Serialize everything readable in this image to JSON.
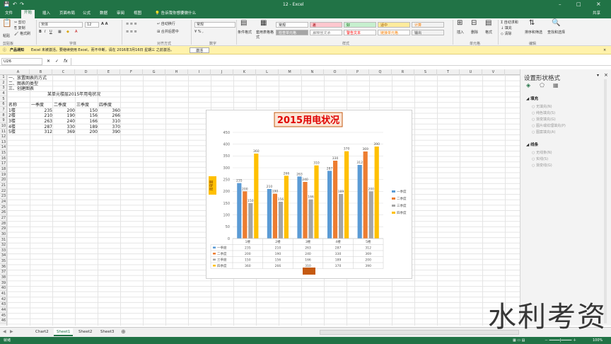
{
  "window": {
    "title": "12 - Excel",
    "share": "共享"
  },
  "tabs": [
    "文件",
    "开始",
    "插入",
    "页面布局",
    "公式",
    "数据",
    "审阅",
    "视图"
  ],
  "tell_me": "告诉我你想要做什么",
  "ribbon": {
    "cut": "剪切",
    "copy": "复制",
    "format_painter": "格式刷",
    "paste": "粘贴",
    "font": "宋体",
    "font_size": "12",
    "wrap": "自动换行",
    "merge": "合并后居中",
    "number_format": "常规",
    "cond_format": "条件格式",
    "table_format": "套用表格格式",
    "styles": [
      "常规",
      "差",
      "好",
      "适中",
      "计算",
      "检查单元格",
      "解释性文本",
      "警告文本",
      "链接单元格",
      "输出"
    ],
    "insert": "插入",
    "delete": "删除",
    "format": "格式",
    "autosum": "自动求和",
    "fill": "填充",
    "clear": "清除",
    "sort": "排序和筛选",
    "find": "查找和选择",
    "groups": [
      "剪贴板",
      "字体",
      "对齐方式",
      "数字",
      "样式",
      "单元格",
      "编辑"
    ]
  },
  "message": {
    "label": "产品通知",
    "text": "Excel 未被激活。要继续使用 Excel，而不中断，请在 2016年3月16日 星期三 之前激活。",
    "button": "激活"
  },
  "formula": {
    "name_box": "U26",
    "fx": "fx"
  },
  "colors": {
    "accent": "#217346",
    "q1": "#5b9bd5",
    "q2": "#ed7d31",
    "q3": "#a5a5a5",
    "q4": "#ffc000"
  },
  "columns": [
    "A",
    "B",
    "C",
    "D",
    "E",
    "F",
    "G",
    "H",
    "I",
    "J",
    "K",
    "L",
    "M",
    "N",
    "O",
    "P",
    "Q",
    "R",
    "S",
    "T",
    "U",
    "V"
  ],
  "rows": [
    "1",
    "2",
    "3",
    "4",
    "5",
    "6",
    "7",
    "8",
    "9",
    "10",
    "11",
    "12",
    "13",
    "14",
    "15",
    "16",
    "17",
    "18",
    "19",
    "20",
    "21",
    "22",
    "23",
    "24",
    "25",
    "26",
    "27",
    "28",
    "29",
    "30",
    "31",
    "32",
    "33",
    "34",
    "35",
    "36",
    "37",
    "38",
    "39",
    "40",
    "41",
    "42",
    "43",
    "44",
    "45",
    "46"
  ],
  "sheet": {
    "lines": [
      "一、放置图表的方式",
      "二、图表的类型",
      "三、创建图表"
    ],
    "table_title": "某单元楼层2015年用电状况",
    "header": [
      "名称",
      "一季度",
      "二季度",
      "三季度",
      "四季度"
    ],
    "rows": [
      [
        "1楼",
        "235",
        "200",
        "150",
        "360"
      ],
      [
        "2楼",
        "210",
        "190",
        "156",
        "266"
      ],
      [
        "3楼",
        "263",
        "240",
        "166",
        "310"
      ],
      [
        "4楼",
        "287",
        "330",
        "189",
        "370"
      ],
      [
        "5楼",
        "312",
        "369",
        "200",
        "390"
      ]
    ]
  },
  "chart_data": {
    "type": "bar",
    "title": "2015用电状况",
    "ylabel": "用电量",
    "categories": [
      "1楼",
      "2楼",
      "3楼",
      "4楼",
      "5楼"
    ],
    "series": [
      {
        "name": "一季度",
        "values": [
          235,
          210,
          263,
          287,
          312
        ]
      },
      {
        "name": "二季度",
        "values": [
          200,
          190,
          240,
          330,
          369
        ]
      },
      {
        "name": "三季度",
        "values": [
          150,
          156,
          166,
          189,
          200
        ]
      },
      {
        "name": "四季度",
        "values": [
          360,
          266,
          310,
          370,
          390
        ]
      }
    ],
    "ylim": [
      0,
      450
    ],
    "yticks": [
      "0",
      "50",
      "100",
      "150",
      "200",
      "250",
      "300",
      "350",
      "400",
      "450"
    ],
    "grid": true,
    "legend": "right",
    "data_table": true
  },
  "pane": {
    "title": "设置形状格式",
    "sections": [
      {
        "name": "填充",
        "items": [
          "无填充(N)",
          "纯色填充(S)",
          "渐变填充(G)",
          "图片或纹理填充(P)",
          "图案填充(A)"
        ]
      },
      {
        "name": "线条",
        "items": [
          "无线条(N)",
          "实线(S)",
          "渐变线(G)"
        ]
      }
    ]
  },
  "sheet_tabs": [
    "Chart2",
    "Sheet1",
    "Sheet2",
    "Sheet3"
  ],
  "active_sheet": "Sheet1",
  "status": {
    "ready": "就绪",
    "zoom": "100%"
  },
  "watermark": "水利考资"
}
